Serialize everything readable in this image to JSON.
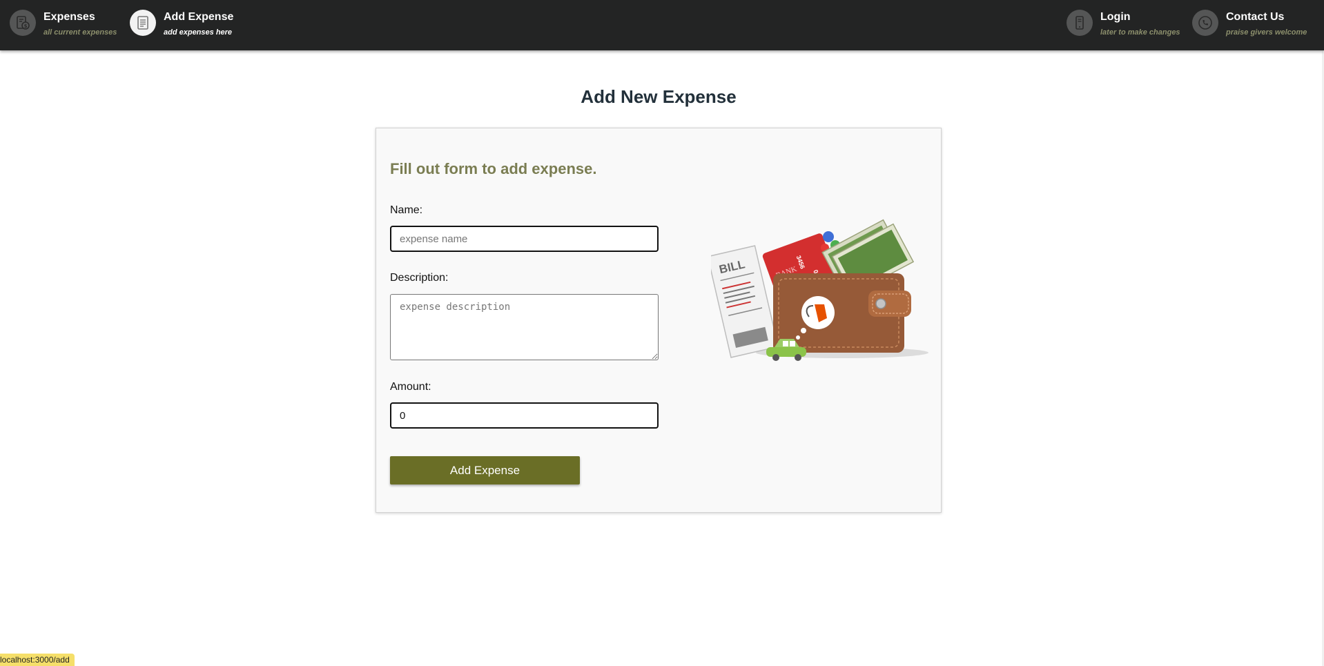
{
  "nav": {
    "items": [
      {
        "title": "Expenses",
        "subtitle": "all current expenses",
        "icon": "expenses-icon",
        "active": false
      },
      {
        "title": "Add Expense",
        "subtitle": "add expenses here",
        "icon": "document-icon",
        "active": true
      },
      {
        "title": "Login",
        "subtitle": "later to make changes",
        "icon": "phone-icon",
        "active": false
      },
      {
        "title": "Contact Us",
        "subtitle": "praise givers welcome",
        "icon": "call-icon",
        "active": false
      }
    ]
  },
  "page": {
    "title": "Add New Expense"
  },
  "form": {
    "heading": "Fill out form to add expense.",
    "name_label": "Name:",
    "name_placeholder": "expense name",
    "name_value": "",
    "description_label": "Description:",
    "description_placeholder": "expense description",
    "description_value": "",
    "amount_label": "Amount:",
    "amount_value": "0",
    "submit_label": "Add Expense"
  },
  "illustration": {
    "bill_text": "BILL",
    "card_bank_text": "BANK",
    "card_number_text": "3456",
    "card_number_partial": "012"
  },
  "status": {
    "url": "localhost:3000/add"
  },
  "colors": {
    "navbar_bg": "#232424",
    "accent_olive": "#6a6e26",
    "heading_olive": "#7a7d52",
    "subtitle_olive": "#8c8f6c",
    "title_dark": "#22303a",
    "status_yellow": "#f5df6a"
  }
}
